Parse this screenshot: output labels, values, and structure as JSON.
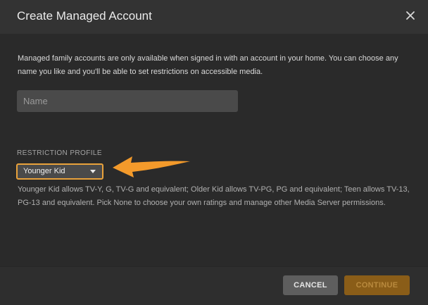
{
  "dialog": {
    "title": "Create Managed Account"
  },
  "intro": {
    "text": "Managed family accounts are only available when signed in with an account in your home. You can choose any name you like and you'll be able to set restrictions on accessible media."
  },
  "name_field": {
    "placeholder": "Name",
    "value": ""
  },
  "restriction": {
    "label": "Restriction Profile",
    "selected": "Younger Kid",
    "help": "Younger Kid allows TV-Y, G, TV-G and equivalent; Older Kid allows TV-PG, PG and equivalent; Teen allows TV-13, PG-13 and equivalent. Pick None to choose your own ratings and manage other Media Server permissions."
  },
  "footer": {
    "cancel_label": "CANCEL",
    "continue_label": "CONTINUE"
  },
  "colors": {
    "accent": "#e5a00d",
    "annotation_arrow": "#f39a2b",
    "background": "#2a2a2a",
    "header": "#333333"
  },
  "icons": {
    "close": "close-icon",
    "caret": "chevron-down-icon",
    "annotation": "arrow-left-annotation"
  }
}
